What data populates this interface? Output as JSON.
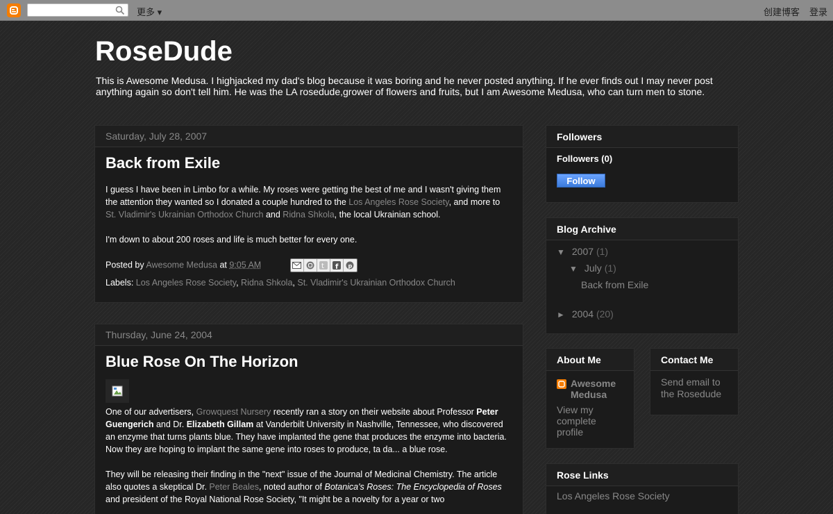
{
  "navbar": {
    "more_label": "更多 ▾",
    "create_blog": "创建博客",
    "login": "登录"
  },
  "header": {
    "title": "RoseDude",
    "description": "This is Awesome Medusa. I highjacked my dad's blog because it was boring and he never posted anything. If he ever finds out I may never post anything again so don't tell him. He was the LA rosedude,grower of flowers and fruits, but I am Awesome Medusa, who can turn men to stone."
  },
  "posts": [
    {
      "date": "Saturday, July 28, 2007",
      "title": "Back from Exile",
      "p1_a": "I guess I have been in Limbo for a while. My roses were getting the best of me and I wasn't giving them the attention they wanted so I donated a couple hundred to the ",
      "p1_link1": "Los Angeles Rose Society",
      "p1_b": ", and more to ",
      "p1_link2": "St. Vladimir's Ukrainian Orthodox Church",
      "p1_c": " and ",
      "p1_link3": "Ridna Shkola",
      "p1_d": ", the local Ukrainian school.",
      "p2": "I'm down to about 200 roses and life is much better for every one.",
      "posted_by": "Posted by ",
      "author": "Awesome Medusa",
      "at": " at ",
      "time": "9:05 AM",
      "labels_prefix": "Labels: ",
      "labels": [
        "Los Angeles Rose Society",
        "Ridna Shkola",
        "St. Vladimir's Ukrainian Orthodox Church"
      ]
    },
    {
      "date": "Thursday, June 24, 2004",
      "title": "Blue Rose On The Horizon",
      "p1_a": "One of our advertisers, ",
      "p1_link1": "Growquest Nursery",
      "p1_b": " recently ran a story on their website about Professor ",
      "p1_bold1": "Peter Guengerich",
      "p1_c": " and Dr. ",
      "p1_bold2": "Elizabeth Gillam",
      "p1_d": " at Vanderbilt University in Nashville, Tennessee, who discovered an enzyme that turns plants blue. They have implanted the gene that produces the enzyme into bacteria. Now they are hoping to implant the same gene into roses to produce, ta da... a blue rose.",
      "p2_a": "They will be releasing their finding in the \"next\" issue of the Journal of Medicinal Chemistry. The article also quotes a skeptical Dr. ",
      "p2_link": "Peter Beales",
      "p2_b": ", noted author of ",
      "p2_italic": "Botanica's Roses: The Encyclopedia of Roses",
      "p2_c": " and president of the Royal National Rose Society, \"It might be a novelty for a year or two"
    }
  ],
  "sidebar": {
    "followers": {
      "title": "Followers",
      "count_label": "Followers (0)",
      "follow_button": "Follow"
    },
    "archive": {
      "title": "Blog Archive",
      "y2007": "2007",
      "y2007_count": "(1)",
      "july": "July",
      "july_count": "(1)",
      "post": "Back from Exile",
      "y2004": "2004",
      "y2004_count": "(20)",
      "expanded_toggle": "▼",
      "collapsed_toggle": "►"
    },
    "about": {
      "title": "About Me",
      "name": "Awesome Medusa",
      "profile_link": "View my complete profile"
    },
    "contact": {
      "title": "Contact Me",
      "link": "Send email to the Rosedude"
    },
    "links": {
      "title": "Rose Links",
      "item1": "Los Angeles Rose Society"
    }
  },
  "colors": {
    "background": "#262626",
    "navbar": "#8c8c8c",
    "panel": "#1b1b1b",
    "link": "#888888",
    "blogger_orange": "#f57d00",
    "follow_blue": "#4a8ae8"
  }
}
